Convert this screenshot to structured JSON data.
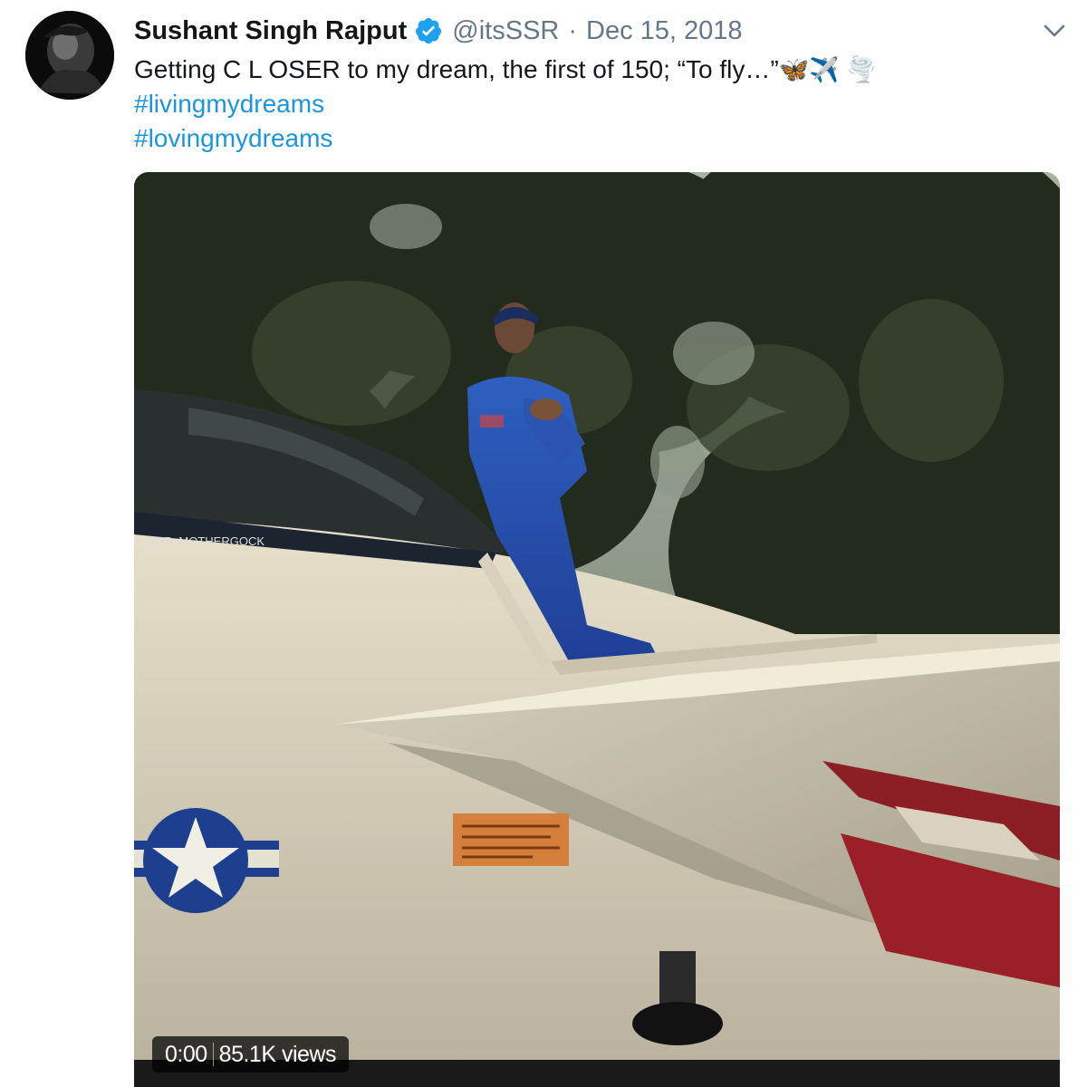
{
  "tweet": {
    "author": {
      "display_name": "Sushant Singh Rajput",
      "handle": "@itsSSR",
      "verified_icon": "verified-badge-icon",
      "avatar_icon": "profile-avatar"
    },
    "separator": "·",
    "date": "Dec 15, 2018",
    "menu_icon": "chevron-down-icon",
    "text": "Getting C L OSER to my dream, the first of 150; “To fly…”",
    "emoji": "🦋✈️ 🌪️",
    "hashtags": [
      "#livingmydreams",
      "#lovingmydreams"
    ],
    "accent_color": "#1b95e0",
    "media": {
      "type": "video",
      "time": "0:00",
      "views": "85.1K views",
      "aircraft_marking": "CDR. MOTHERGOCK"
    }
  }
}
